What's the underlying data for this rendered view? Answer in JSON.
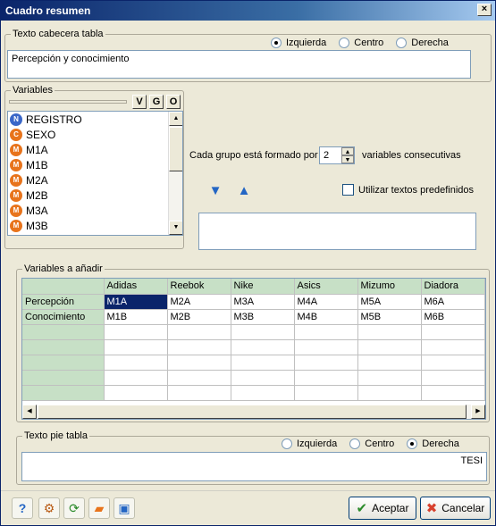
{
  "window": {
    "title": "Cuadro resumen",
    "close_glyph": "×"
  },
  "header": {
    "legend": "Texto cabecera tabla",
    "text": "Percepción y conocimiento",
    "alignment_options": [
      {
        "label": "Izquierda",
        "checked": true
      },
      {
        "label": "Centro",
        "checked": false
      },
      {
        "label": "Derecha",
        "checked": false
      }
    ]
  },
  "variables": {
    "legend": "Variables",
    "buttons": [
      "V",
      "G",
      "O"
    ],
    "items": [
      {
        "type": "N",
        "name": "REGISTRO",
        "color": "#3a67c8"
      },
      {
        "type": "C",
        "name": "SEXO",
        "color": "#e8741c"
      },
      {
        "type": "M",
        "name": "M1A",
        "color": "#e8741c"
      },
      {
        "type": "M",
        "name": "M1B",
        "color": "#e8741c"
      },
      {
        "type": "M",
        "name": "M2A",
        "color": "#e8741c"
      },
      {
        "type": "M",
        "name": "M2B",
        "color": "#e8741c"
      },
      {
        "type": "M",
        "name": "M3A",
        "color": "#e8741c"
      },
      {
        "type": "M",
        "name": "M3B",
        "color": "#e8741c"
      }
    ]
  },
  "grouping": {
    "prefix": "Cada grupo está formado por",
    "value": "2",
    "suffix": "variables consecutivas",
    "predefined_label": "Utilizar textos predefinidos",
    "predefined_checked": false
  },
  "add_vars": {
    "legend": "Variables a añadir",
    "columns": [
      "",
      "Adidas",
      "Reebok",
      "Nike",
      "Asics",
      "Mizumo",
      "Diadora"
    ],
    "rows": [
      [
        "Percepción",
        "M1A",
        "M2A",
        "M3A",
        "M4A",
        "M5A",
        "M6A"
      ],
      [
        "Conocimiento",
        "M1B",
        "M2B",
        "M3B",
        "M4B",
        "M5B",
        "M6B"
      ],
      [
        "",
        "",
        "",
        "",
        "",
        "",
        ""
      ],
      [
        "",
        "",
        "",
        "",
        "",
        "",
        ""
      ],
      [
        "",
        "",
        "",
        "",
        "",
        "",
        ""
      ],
      [
        "",
        "",
        "",
        "",
        "",
        "",
        ""
      ],
      [
        "",
        "",
        "",
        "",
        "",
        "",
        ""
      ]
    ]
  },
  "footer": {
    "legend": "Texto pie tabla",
    "text": "TESI",
    "alignment_options": [
      {
        "label": "Izquierda",
        "checked": false
      },
      {
        "label": "Centro",
        "checked": false
      },
      {
        "label": "Derecha",
        "checked": true
      }
    ]
  },
  "actions": {
    "accept_label": "Aceptar",
    "cancel_label": "Cancelar",
    "accent": "#003c74"
  }
}
